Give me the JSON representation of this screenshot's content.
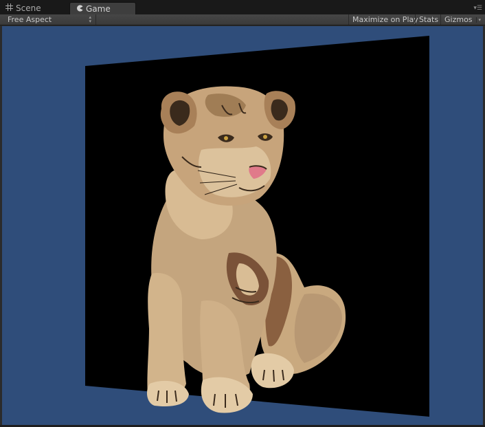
{
  "tabs": [
    {
      "label": "Scene",
      "icon": "scene-grid-icon",
      "active": false
    },
    {
      "label": "Game",
      "icon": "game-pacman-icon",
      "active": true
    }
  ],
  "tab_menu_icon": "tab-menu-icon",
  "toolbar": {
    "aspect_label": "Free Aspect",
    "maximize_label": "Maximize on Play",
    "stats_label": "Stats",
    "gizmos_label": "Gizmos"
  },
  "viewport": {
    "background_color": "#2f4d7a",
    "quad_color": "#000000",
    "content": "lion-cub-illustration"
  }
}
